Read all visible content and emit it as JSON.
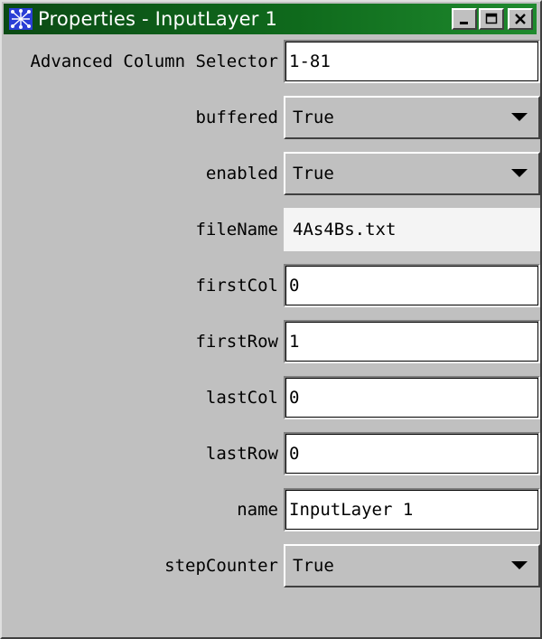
{
  "window": {
    "title": "Properties - InputLayer 1"
  },
  "properties": [
    {
      "label": "Advanced Column Selector",
      "value": "1-81",
      "type": "text"
    },
    {
      "label": "buffered",
      "value": "True",
      "type": "select"
    },
    {
      "label": "enabled",
      "value": "True",
      "type": "select"
    },
    {
      "label": "fileName",
      "value": "4As4Bs.txt",
      "type": "readonly"
    },
    {
      "label": "firstCol",
      "value": "0",
      "type": "text"
    },
    {
      "label": "firstRow",
      "value": "1",
      "type": "text"
    },
    {
      "label": "lastCol",
      "value": "0",
      "type": "text"
    },
    {
      "label": "lastRow",
      "value": "0",
      "type": "text"
    },
    {
      "label": "name",
      "value": "InputLayer 1",
      "type": "text"
    },
    {
      "label": "stepCounter",
      "value": "True",
      "type": "select"
    }
  ],
  "icons": {
    "app": "app-icon",
    "minimize": "minimize-icon",
    "maximize": "maximize-icon",
    "close": "close-icon",
    "dropdown": "chevron-down-icon"
  }
}
